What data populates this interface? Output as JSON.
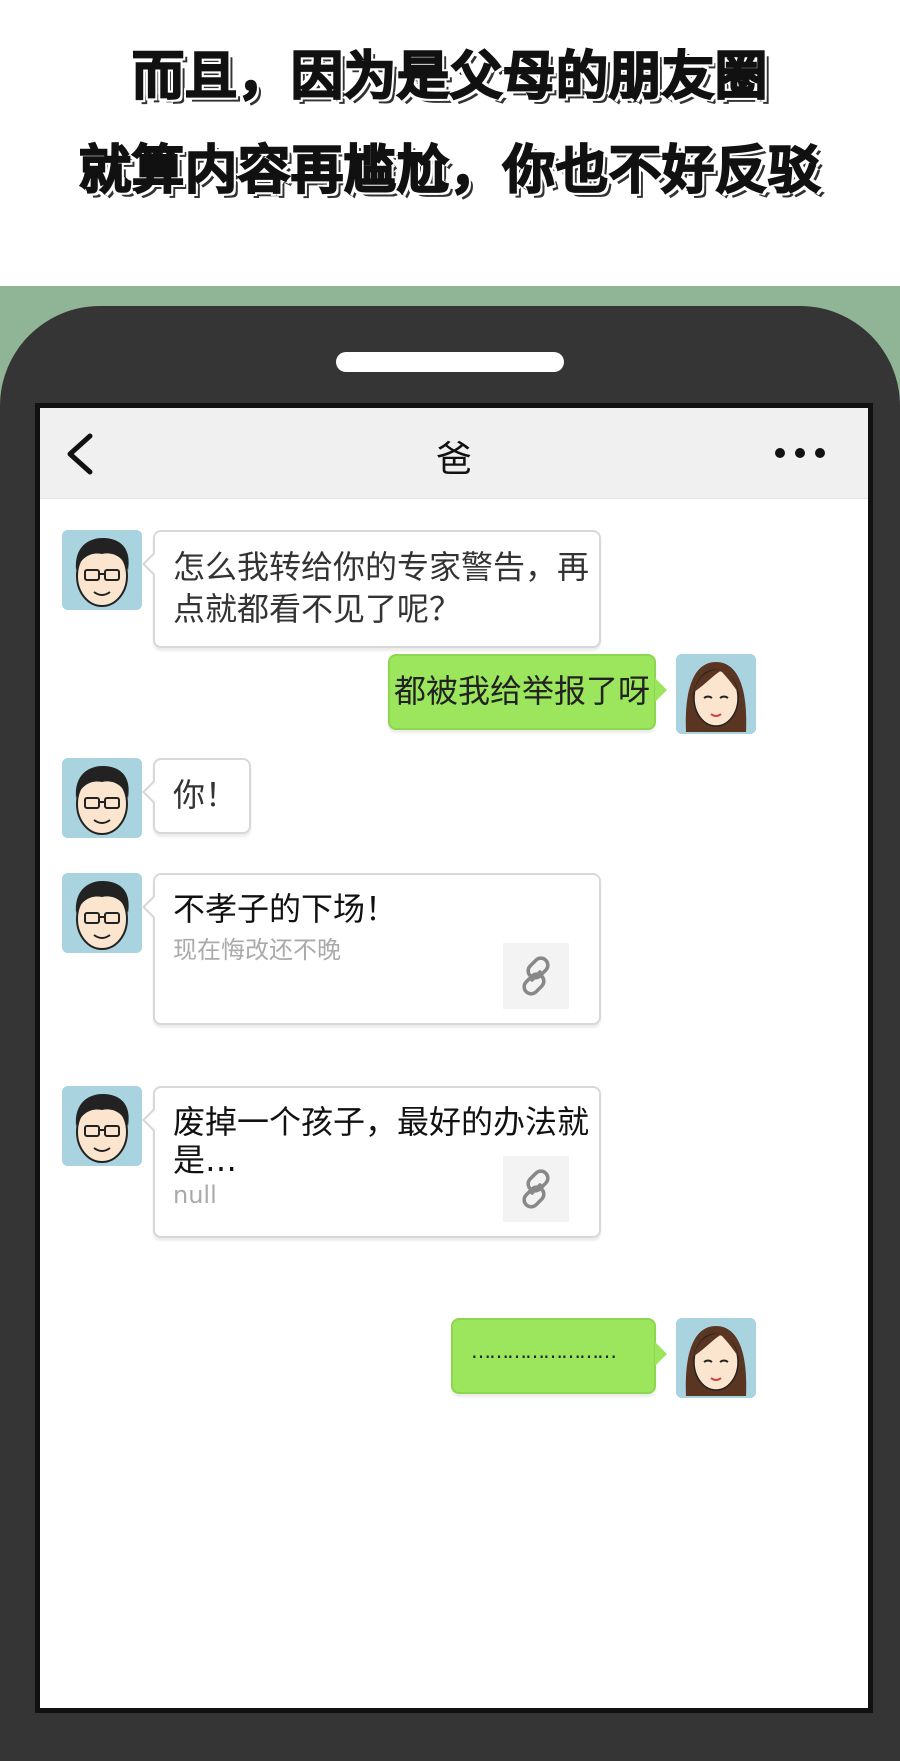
{
  "caption": {
    "line1": "而且，因为是父母的朋友圈",
    "line2": "就算内容再尴尬，你也不好反驳"
  },
  "chat": {
    "title": "爸",
    "back_icon": "chevron-left-icon",
    "more_icon": "ellipsis-icon"
  },
  "messages": [
    {
      "from": "dad",
      "text_line1": "怎么我转给你的专家警告，再",
      "text_line2": "点就都看不见了呢？"
    },
    {
      "from": "me",
      "text": "都被我给举报了呀"
    },
    {
      "from": "dad",
      "text": "你！"
    },
    {
      "from": "dad",
      "type": "link",
      "title": "不孝子的下场！",
      "desc": "现在悔改还不晚"
    },
    {
      "from": "dad",
      "type": "link",
      "title_line1": "废掉一个孩子，最好的办法就",
      "title_line2": "是…",
      "desc": "null"
    },
    {
      "from": "me",
      "text": "……………………"
    }
  ],
  "colors": {
    "green_bubble": "#9be65c",
    "phone_body": "#353535",
    "background_green": "#8fb596"
  }
}
